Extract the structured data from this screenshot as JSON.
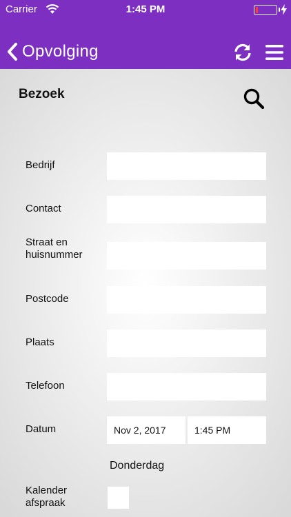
{
  "status_bar": {
    "carrier": "Carrier",
    "time": "1:45 PM",
    "battery_level": 0.12,
    "battery_color": "#ff3b30"
  },
  "nav": {
    "back_label": "Opvolging",
    "back_icon": "chevron-left-icon",
    "refresh_icon": "refresh-icon",
    "menu_icon": "hamburger-menu-icon",
    "background_color": "#7d2fc2"
  },
  "page": {
    "title": "Bezoek",
    "search_icon": "search-icon"
  },
  "form": {
    "fields": [
      {
        "label": "Bedrijf",
        "value": ""
      },
      {
        "label": "Contact",
        "value": ""
      },
      {
        "label": "Straat en huisnummer",
        "value": ""
      },
      {
        "label": "Postcode",
        "value": ""
      },
      {
        "label": "Plaats",
        "value": ""
      },
      {
        "label": "Telefoon",
        "value": ""
      }
    ],
    "datum": {
      "label": "Datum",
      "date_value": "Nov 2, 2017",
      "time_value": "1:45 PM",
      "weekday": "Donderdag"
    },
    "kalender": {
      "label": "Kalender afspraak",
      "checked": false
    }
  }
}
